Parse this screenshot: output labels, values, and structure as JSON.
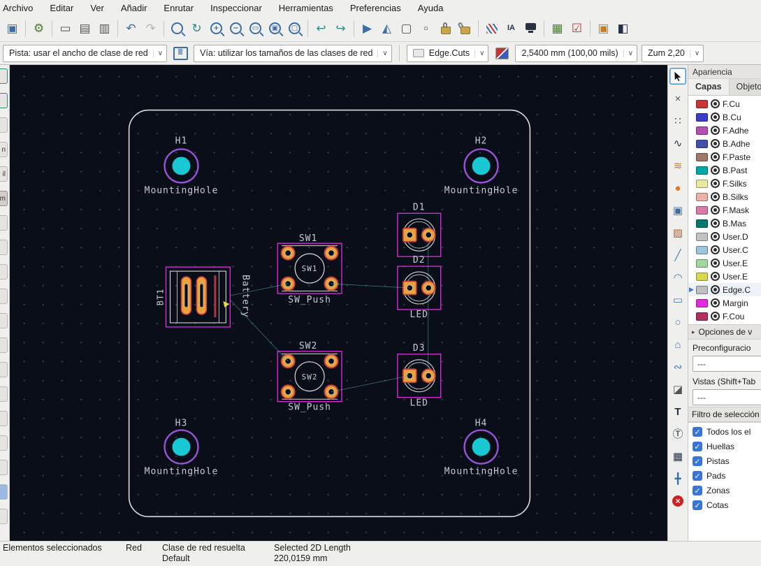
{
  "menubar": {
    "items": [
      "Archivo",
      "Editar",
      "Ver",
      "Añadir",
      "Enrutar",
      "Inspeccionar",
      "Herramientas",
      "Preferencias",
      "Ayuda"
    ]
  },
  "icons": {
    "save": "▣",
    "board_setup": "⚙",
    "page_setup": "▭",
    "print": "▤",
    "plot": "▥",
    "undo": "↶",
    "redo": "↷",
    "refresh": "↻",
    "zoom_in": "+",
    "zoom_out": "−",
    "zoom_fit": "▭",
    "zoom_objects": "▣",
    "zoom_selection": "▢",
    "rotate_ccw": "↩",
    "rotate_cw": "↪",
    "flip": "▶",
    "mirror": "◭",
    "group": "▢",
    "ungroup": "▫",
    "net_inspector": "IA",
    "update_pcb": "▦",
    "drc": "☑",
    "footprint_editor": "▣",
    "layers_manager": "◧",
    "track_width": "≣",
    "caret": "∨",
    "check": "✓",
    "collapse_arrow": "▸",
    "active_layer": "▶",
    "highlight_net": "×",
    "local_ratsnest": "∷",
    "route": "∿",
    "tune": "≋",
    "via": "●",
    "footprint": "▣",
    "zone": "▨",
    "line": "╱",
    "arc": "◠",
    "rectangle": "▭",
    "circle": "○",
    "polygon": "⌂",
    "bezier": "∾",
    "image": "◪",
    "text": "T",
    "textbox": "Ⓣ",
    "table": "▦",
    "origin": "╋",
    "delete": "×"
  },
  "controls": {
    "track_combo": "Pista: usar el ancho de clase de red",
    "via_combo": "Vía: utilizar los tamaños de las clases de red",
    "layer_combo": "Edge.Cuts",
    "layer_swatch_color": "#e8e8e8",
    "grid_combo": "2,5400 mm (100,00 mils)",
    "zoom_combo": "Zum 2,20"
  },
  "left_toolbar": {
    "fragments": [
      "n",
      "il",
      "m"
    ]
  },
  "canvas": {
    "labels": {
      "h1": "H1",
      "h2": "H2",
      "h3": "H3",
      "h4": "H4",
      "mounting_hole": "MountingHole",
      "bt1": "BT1",
      "battery": "Battery",
      "sw1": "SW1",
      "sw2": "SW2",
      "sw_push": "SW_Push",
      "d1": "D1",
      "d2": "D2",
      "d3": "D3",
      "led": "LED"
    }
  },
  "appearance_panel": {
    "title": "Apariencia",
    "tabs": [
      {
        "label": "Capas",
        "active": true
      },
      {
        "label": "Objeto",
        "active": false
      }
    ],
    "layers": [
      {
        "name": "F.Cu",
        "color": "#c83434"
      },
      {
        "name": "B.Cu",
        "color": "#3c3cc8"
      },
      {
        "name": "F.Adhe",
        "color": "#b44fb4"
      },
      {
        "name": "B.Adhe",
        "color": "#4350a8"
      },
      {
        "name": "F.Paste",
        "color": "#a0786c"
      },
      {
        "name": "B.Past",
        "color": "#00a8a8"
      },
      {
        "name": "F.Silks",
        "color": "#e8e8a0"
      },
      {
        "name": "B.Silks",
        "color": "#e8b2a7"
      },
      {
        "name": "F.Mask",
        "color": "#d87ca8"
      },
      {
        "name": "B.Mas",
        "color": "#02796e"
      },
      {
        "name": "User.D",
        "color": "#c2c2c2"
      },
      {
        "name": "User.C",
        "color": "#9fc4dc"
      },
      {
        "name": "User.E",
        "color": "#9fd89f"
      },
      {
        "name": "User.E",
        "color": "#d8d850"
      },
      {
        "name": "Edge.C",
        "color": "#bfbfbf",
        "active": true
      },
      {
        "name": "Margin",
        "color": "#e02ce0"
      },
      {
        "name": "F.Cou",
        "color": "#b03060"
      }
    ],
    "net_options_header": "Opciones de v",
    "presets_label": "Preconfiguracio",
    "presets_value": "---",
    "viewports_label": "Vistas (Shift+Tab",
    "viewports_value": "---",
    "selection_filter_title": "Filtro de selección",
    "selection_filters": [
      {
        "label": "Todos los el",
        "checked": true
      },
      {
        "label": "Huellas",
        "checked": true
      },
      {
        "label": "Pistas",
        "checked": true
      },
      {
        "label": "Pads",
        "checked": true
      },
      {
        "label": "Zonas",
        "checked": true
      },
      {
        "label": "Cotas",
        "checked": true
      }
    ]
  },
  "statusbar": {
    "col1": "Elementos seleccionados",
    "col2": "Red",
    "col3_label": "Clase de red resuelta",
    "col3_value": "Default",
    "col4_label": "Selected 2D Length",
    "col4_value": "220,0159 mm"
  },
  "colors": {
    "canvas_bg": "#0a0e18",
    "courtyard_magenta": "#e32ce3",
    "pad_fill": "#e8a33d",
    "pad_ring": "#c84040",
    "mounting_ring_purple": "#9b51d6",
    "mounting_fill_cyan": "#1ac8d4",
    "silkscreen": "#d8d8d8",
    "ratsnest_cyan": "#58c8c8",
    "board_outline": "#dcdcdc",
    "canvas_text": "#c6cbd0",
    "accent_blue": "#3875d7"
  }
}
